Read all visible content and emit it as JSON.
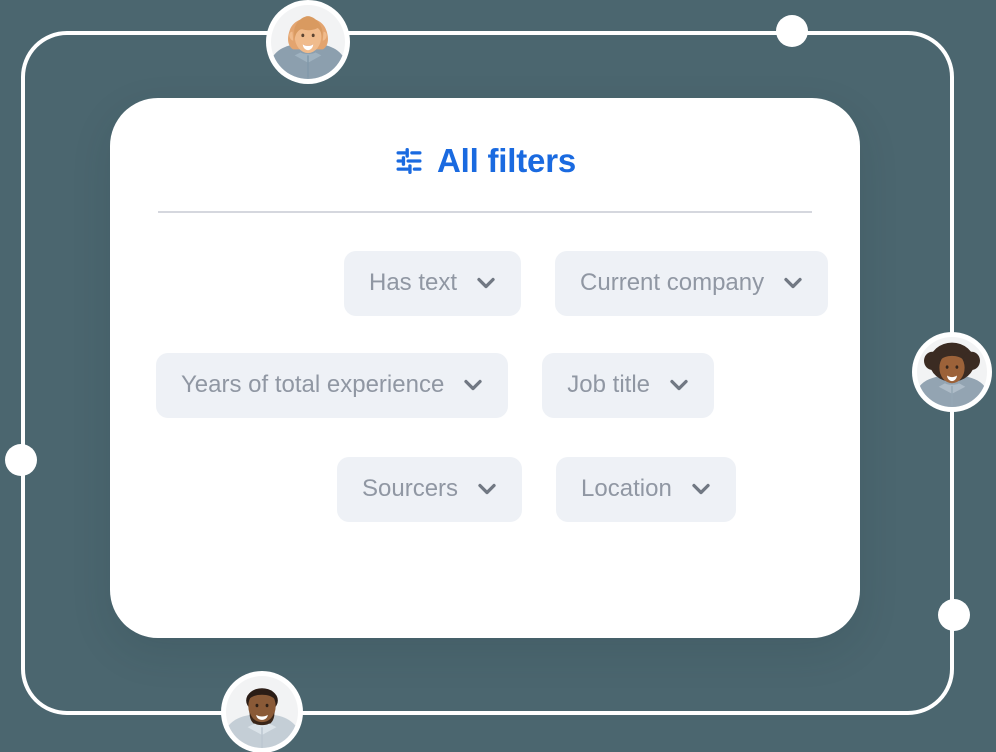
{
  "theme": {
    "page_background": "#4b666f",
    "card_background": "#ffffff",
    "accent": "#1a6ae0",
    "pill_background": "#eef1f6",
    "pill_text": "#9097a3",
    "divider": "#d5d7de",
    "frame_stroke": "#ffffff"
  },
  "card": {
    "title": "All filters",
    "title_icon": "filter-sliders-icon"
  },
  "filters": {
    "rows": [
      {
        "pills": [
          {
            "label": "Has text",
            "icon": "chevron-down-icon"
          },
          {
            "label": "Current company",
            "icon": "chevron-down-icon"
          }
        ]
      },
      {
        "pills": [
          {
            "label": "Years of total experience",
            "icon": "chevron-down-icon"
          },
          {
            "label": "Job title",
            "icon": "chevron-down-icon"
          }
        ]
      },
      {
        "pills": [
          {
            "label": "Sourcers",
            "icon": "chevron-down-icon"
          },
          {
            "label": "Location",
            "icon": "chevron-down-icon"
          }
        ]
      }
    ]
  },
  "decorations": {
    "frame_dots": [
      {
        "name": "frame-dot-top-right"
      },
      {
        "name": "frame-dot-left"
      },
      {
        "name": "frame-dot-bottom-right"
      }
    ],
    "avatars": [
      {
        "name": "avatar-top",
        "description": "smiling woman with blonde wavy hair"
      },
      {
        "name": "avatar-right",
        "description": "smiling woman with curly dark hair"
      },
      {
        "name": "avatar-bottom",
        "description": "smiling man with beard in light shirt"
      }
    ]
  }
}
